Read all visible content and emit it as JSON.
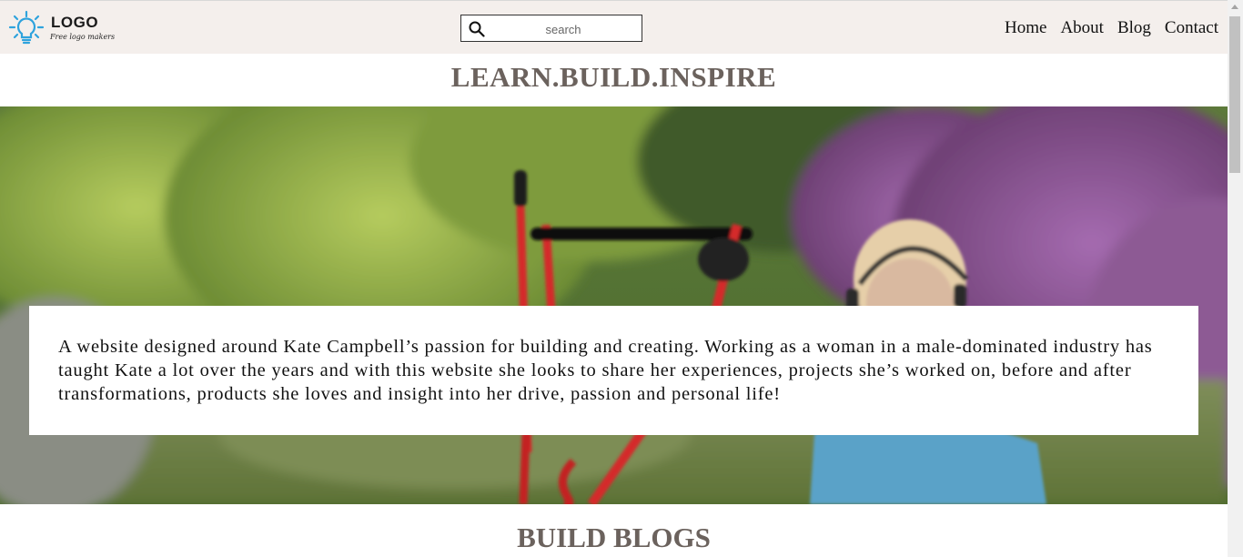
{
  "header": {
    "logo_text": "LOGO",
    "logo_tagline": "Free logo makers",
    "search_placeholder": "search",
    "nav": [
      "Home",
      "About",
      "Blog",
      "Contact"
    ]
  },
  "hero": {
    "title": "LEARN.BUILD.INSPIRE",
    "intro": "A website designed around Kate Campbell’s passion for building and creating. Working as a woman in a male-dominated industry has taught Kate a lot over the years and with this website she looks to share her experiences, projects she’s worked on, before and after transformations, products she loves and insight into her drive, passion and personal life!",
    "image_icon": "hero-photo-mower"
  },
  "sections": {
    "blogs_title": "BUILD BLOGS"
  },
  "colors": {
    "header_bg": "#f4efec",
    "title_color": "#6b625d",
    "logo_accent": "#2fa3dd"
  }
}
